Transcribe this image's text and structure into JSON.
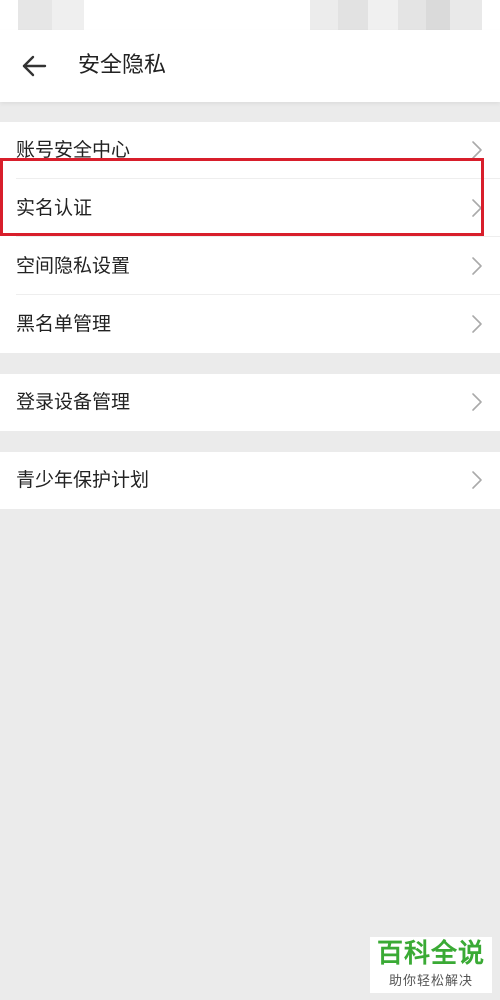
{
  "header": {
    "title": "安全隐私"
  },
  "groups": [
    {
      "items": [
        {
          "label": "账号安全中心"
        },
        {
          "label": "实名认证"
        },
        {
          "label": "空间隐私设置"
        },
        {
          "label": "黑名单管理"
        }
      ]
    },
    {
      "items": [
        {
          "label": "登录设备管理"
        }
      ]
    },
    {
      "items": [
        {
          "label": "青少年保护计划"
        }
      ]
    }
  ],
  "watermark": {
    "main": "百科全说",
    "sub": "助你轻松解决"
  },
  "colors": {
    "highlight": "#d81e2b",
    "watermark_green": "#3aaa35",
    "background": "#ebebeb"
  }
}
